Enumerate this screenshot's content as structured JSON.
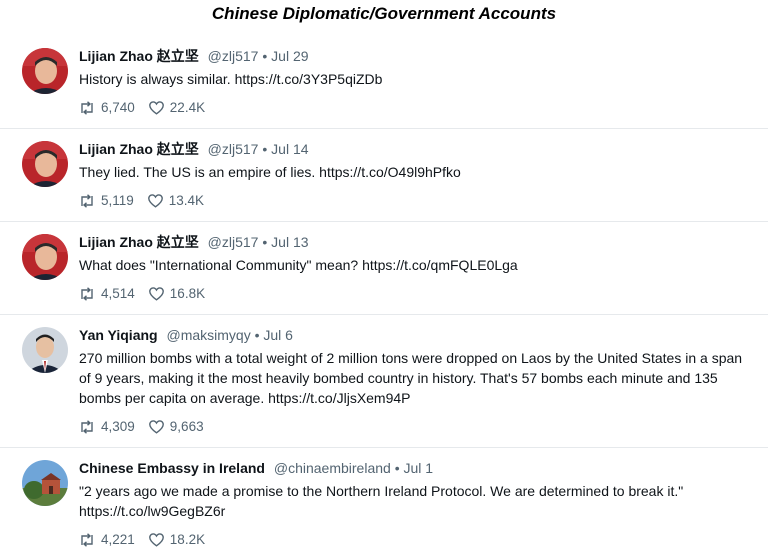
{
  "page_title": "Chinese Diplomatic/Government Accounts",
  "tweets": [
    {
      "name": "Lijian Zhao 赵立坚",
      "handle": "@zlj517",
      "dot": "•",
      "date": "Jul 29",
      "text": "History is always similar. https://t.co/3Y3P5qiZDb",
      "retweets": "6,740",
      "likes": "22.4K"
    },
    {
      "name": "Lijian Zhao 赵立坚",
      "handle": "@zlj517",
      "dot": "•",
      "date": "Jul 14",
      "text": "They lied. The US is an empire of lies. https://t.co/O49l9hPfko",
      "retweets": "5,119",
      "likes": "13.4K"
    },
    {
      "name": "Lijian Zhao 赵立坚",
      "handle": "@zlj517",
      "dot": "•",
      "date": "Jul 13",
      "text": "What does \"International Community\" mean? https://t.co/qmFQLE0Lga",
      "retweets": "4,514",
      "likes": "16.8K"
    },
    {
      "name": "Yan Yiqiang",
      "handle": "@maksimyqy",
      "dot": "•",
      "date": "Jul 6",
      "text": "270 million bombs with a total weight of 2 million tons were dropped on Laos by the United States in a span of 9 years, making it the most heavily bombed country in history. That's 57 bombs each minute and 135 bombs per capita on average. https://t.co/JljsXem94P",
      "retweets": "4,309",
      "likes": "9,663"
    },
    {
      "name": "Chinese Embassy in Ireland",
      "handle": "@chinaembireland",
      "dot": "•",
      "date": "Jul 1",
      "text": "\"2 years ago we made a promise to the Northern Ireland Protocol. We are determined to break it.\" https://t.co/lw9GegBZ6r",
      "retweets": "4,221",
      "likes": "18.2K"
    }
  ],
  "icons": {
    "retweet": "retweet-icon",
    "like": "heart-icon"
  },
  "colors": {
    "muted": "#536471",
    "text": "#0f1419",
    "divider": "#e6e9ec"
  }
}
